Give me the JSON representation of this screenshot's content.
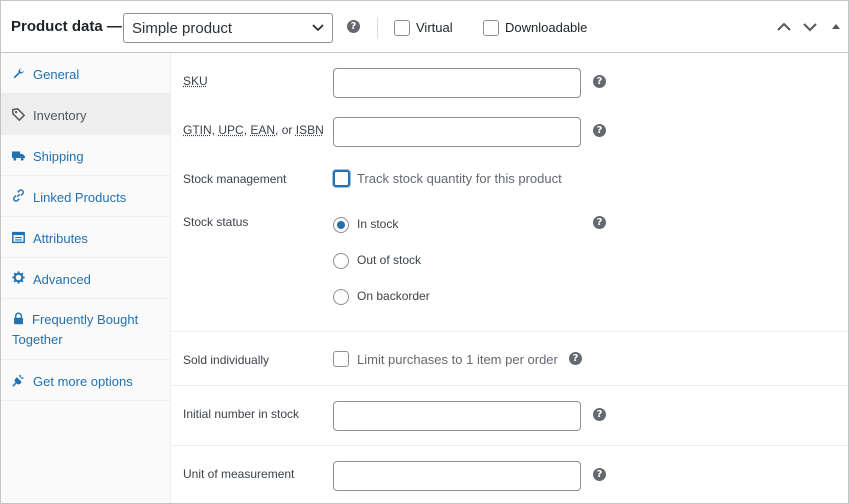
{
  "header": {
    "title": "Product data —",
    "product_type": "Simple product",
    "virtual_label": "Virtual",
    "downloadable_label": "Downloadable"
  },
  "tabs": [
    {
      "label": "General",
      "icon": "wrench-icon"
    },
    {
      "label": "Inventory",
      "icon": "tag-icon",
      "active": true
    },
    {
      "label": "Shipping",
      "icon": "truck-icon"
    },
    {
      "label": "Linked Products",
      "icon": "link-icon"
    },
    {
      "label": "Attributes",
      "icon": "table-icon"
    },
    {
      "label": "Advanced",
      "icon": "gear-icon"
    },
    {
      "label": "Frequently Bought Together",
      "icon": "lock-icon"
    },
    {
      "label": "Get more options",
      "icon": "plug-icon"
    }
  ],
  "fields": {
    "sku_label": "SKU",
    "sku_value": "",
    "gtin_label": {
      "gtin": "GTIN",
      "upc": "UPC",
      "ean": "EAN",
      "or": "or",
      "isbn": "ISBN"
    },
    "gtin_value": "",
    "stock_management_label": "Stock management",
    "stock_management_text": "Track stock quantity for this product",
    "stock_status_label": "Stock status",
    "stock_status_options": [
      "In stock",
      "Out of stock",
      "On backorder"
    ],
    "stock_status_selected": "In stock",
    "sold_individually_label": "Sold individually",
    "sold_individually_text": "Limit purchases to 1 item per order",
    "initial_stock_label": "Initial number in stock",
    "initial_stock_value": "",
    "unit_label": "Unit of measurement",
    "unit_value": ""
  },
  "colors": {
    "accent": "#2271b1",
    "border": "#c3c4c7",
    "help_icon": "#646970"
  }
}
